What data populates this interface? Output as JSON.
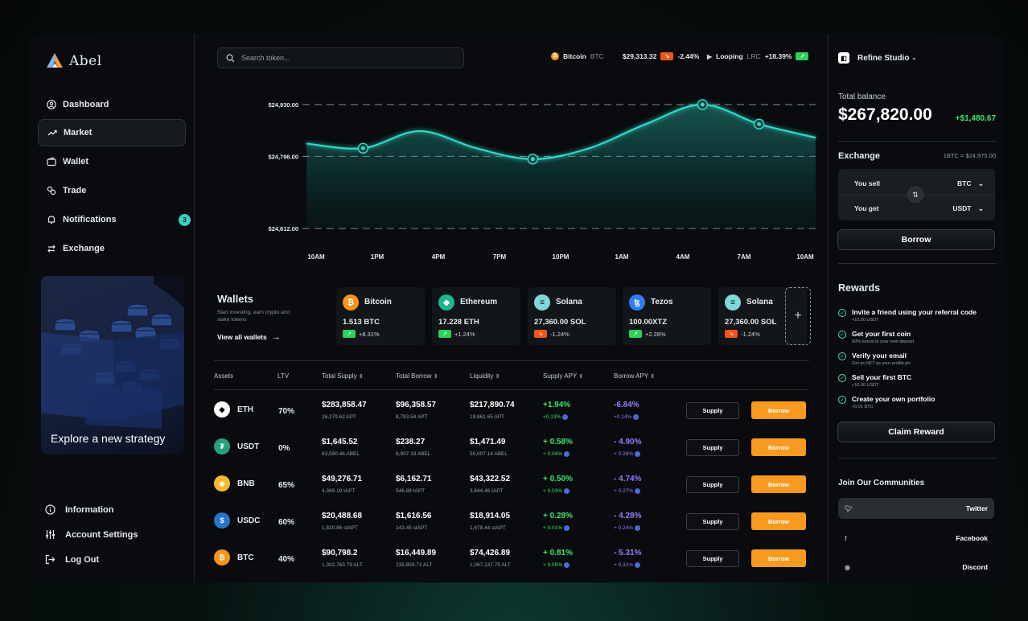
{
  "app": {
    "name": "Abel"
  },
  "nav": [
    {
      "label": "Dashboard",
      "icon": "user-circle-icon"
    },
    {
      "label": "Market",
      "icon": "trend-icon",
      "active": true
    },
    {
      "label": "Wallet",
      "icon": "wallet-icon"
    },
    {
      "label": "Trade",
      "icon": "trade-icon"
    },
    {
      "label": "Notifications",
      "icon": "bell-icon",
      "badge": "3"
    },
    {
      "label": "Exchange",
      "icon": "exchange-icon"
    }
  ],
  "promo": {
    "title": "Explore a new strategy"
  },
  "bottom_nav": [
    {
      "label": "Information",
      "icon": "info-icon"
    },
    {
      "label": "Account Settings",
      "icon": "sliders-icon"
    },
    {
      "label": "Log Out",
      "icon": "logout-icon"
    }
  ],
  "search": {
    "placeholder": "Search token..."
  },
  "tickers": [
    {
      "name": "Bitcoin",
      "symbol": "BTC",
      "price": "$29,313.32",
      "change": "-2.44%",
      "direction": "down",
      "color": "#f7931a"
    },
    {
      "name": "Looping",
      "symbol": "LRC",
      "change": "+18.39%",
      "direction": "up"
    }
  ],
  "chart_data": {
    "type": "area",
    "x": [
      "10AM",
      "1PM",
      "4PM",
      "7PM",
      "10PM",
      "1AM",
      "4AM",
      "7AM",
      "10AM"
    ],
    "y_ticks": [
      "$24,930.00",
      "$24,796.00",
      "$24,612.00"
    ],
    "ylim": [
      24612,
      24930
    ],
    "series": [
      {
        "values": [
          24830,
          24818,
          24862,
          24818,
          24790,
          24818,
          24880,
          24930,
          24880,
          24845
        ]
      }
    ],
    "highlight_indices": [
      1,
      4,
      7,
      8
    ],
    "color": "#2fd9c9"
  },
  "wallets": {
    "title": "Wallets",
    "subtitle": "Start investing, earn crypto and stake tokens",
    "link": "View all wallets",
    "cards": [
      {
        "name": "Bitcoin",
        "amount": "1.513 BTC",
        "change": "+8.31%",
        "direction": "up",
        "icon_color": "#f7931a",
        "icon_glyph": "₿"
      },
      {
        "name": "Ethereum",
        "amount": "17.228 ETH",
        "change": "+1.24%",
        "direction": "up",
        "icon_color": "#1fb58f",
        "icon_glyph": "◆"
      },
      {
        "name": "Solana",
        "amount": "27,360.00 SOL",
        "change": "-1.24%",
        "direction": "down",
        "icon_color": "#7fd8d8",
        "icon_glyph": "≡"
      },
      {
        "name": "Tezos",
        "amount": "100.00XTZ",
        "change": "+2.28%",
        "direction": "up",
        "icon_color": "#2c7df7",
        "icon_glyph": "ꜩ"
      },
      {
        "name": "Solana",
        "amount": "27,360.00 SOL",
        "change": "-1.24%",
        "direction": "down",
        "icon_color": "#7fd8d8",
        "icon_glyph": "≡"
      }
    ]
  },
  "table": {
    "headers": [
      "Assets",
      "LTV",
      "Total Supply",
      "Total Borrow",
      "Liquidity",
      "Supply APY",
      "Borrow APY"
    ],
    "supply_label": "Supply",
    "borrow_label": "Borrow",
    "rows": [
      {
        "asset": "ETH",
        "icon_color": "#ffffff",
        "icon_glyph": "◆",
        "ltv": "70%",
        "supply": "$283,858.47",
        "supply_sub": "26,279.62 APT",
        "borrow": "$96,358.57",
        "borrow_sub": "8,783.54 APT",
        "liquidity": "$217,890.74",
        "liquidity_sub": "19,861.65 APT",
        "supply_apy": "+1.94%",
        "supply_apy_sub": "+0.13%",
        "borrow_apy": "-6.84%",
        "borrow_apy_sub": "+0.14%"
      },
      {
        "asset": "USDT",
        "icon_color": "#26a17b",
        "icon_glyph": "₮",
        "ltv": "0%",
        "supply": "$1,645.52",
        "supply_sub": "63,590.46 ABEL",
        "borrow": "$238.27",
        "borrow_sub": "8,907.19 ABEL",
        "liquidity": "$1,471.49",
        "liquidity_sub": "55,007.14 ABEL",
        "supply_apy": "+ 0.58%",
        "supply_apy_sub": "+ 0.04%",
        "borrow_apy": "- 4.90%",
        "borrow_apy_sub": "+ 0.28%"
      },
      {
        "asset": "BNB",
        "icon_color": "#f3ba2f",
        "icon_glyph": "◈",
        "ltv": "65%",
        "supply": "$49,276.71",
        "supply_sub": "4,389.19 tAPT",
        "borrow": "$6,162.71",
        "borrow_sub": "546.88 tAPT",
        "liquidity": "$43,322.52",
        "liquidity_sub": "3,844.46 tAPT",
        "supply_apy": "+ 0.50%",
        "supply_apy_sub": "+ 0.03%",
        "borrow_apy": "- 4.74%",
        "borrow_apy_sub": "+ 0.27%"
      },
      {
        "asset": "USDC",
        "icon_color": "#2775ca",
        "icon_glyph": "$",
        "ltv": "60%",
        "supply": "$20,488.68",
        "supply_sub": "1,820.86 stAPT",
        "borrow": "$1,616.56",
        "borrow_sub": "143.45 stAPT",
        "liquidity": "$18,914.05",
        "liquidity_sub": "1,678.44 stAPT",
        "supply_apy": "+ 0.28%",
        "supply_apy_sub": "+ 0.01%",
        "borrow_apy": "- 4.28%",
        "borrow_apy_sub": "+ 0.24%"
      },
      {
        "asset": "BTC",
        "icon_color": "#f7931a",
        "icon_glyph": "₿",
        "ltv": "40%",
        "supply": "$90,798.2",
        "supply_sub": "1,302,763.79 ALT",
        "borrow": "$16,449.89",
        "borrow_sub": "235,859.71 ALT",
        "liquidity": "$74,426.89",
        "liquidity_sub": "1,067,137.75 ALT",
        "supply_apy": "+ 0.81%",
        "supply_apy_sub": "+ 0.05%",
        "borrow_apy": "- 5.31%",
        "borrow_apy_sub": "+ 0.31%"
      }
    ]
  },
  "right": {
    "studio": "Refine Studio",
    "total_balance_label": "Total balance",
    "total_balance": "$267,820.00",
    "balance_change": "+$1,480.67",
    "exchange_title": "Exchange",
    "exchange_rate": "1BTC = $24,975.00",
    "sell_label": "You sell",
    "sell_currency": "BTC",
    "get_label": "You get",
    "get_currency": "USDT",
    "borrow_button": "Borrow",
    "rewards_title": "Rewards",
    "rewards": [
      {
        "title": "Invite a friend using your referral code",
        "sub": "+10,00 USDT"
      },
      {
        "title": "Get your first coin",
        "sub": "50% bonus to your next deposit"
      },
      {
        "title": "Verify your email",
        "sub": "Get an NFT as your profile pic"
      },
      {
        "title": "Sell your first BTC",
        "sub": "+10,00 USDT"
      },
      {
        "title": "Create your own portfolio",
        "sub": "+0.01 BTC"
      }
    ],
    "claim_button": "Claim Reward",
    "communities_title": "Join Our Communities",
    "communities": [
      {
        "name": "Twitter",
        "icon": "twitter-icon"
      },
      {
        "name": "Facebook",
        "icon": "facebook-icon"
      },
      {
        "name": "Discord",
        "icon": "discord-icon"
      }
    ]
  }
}
